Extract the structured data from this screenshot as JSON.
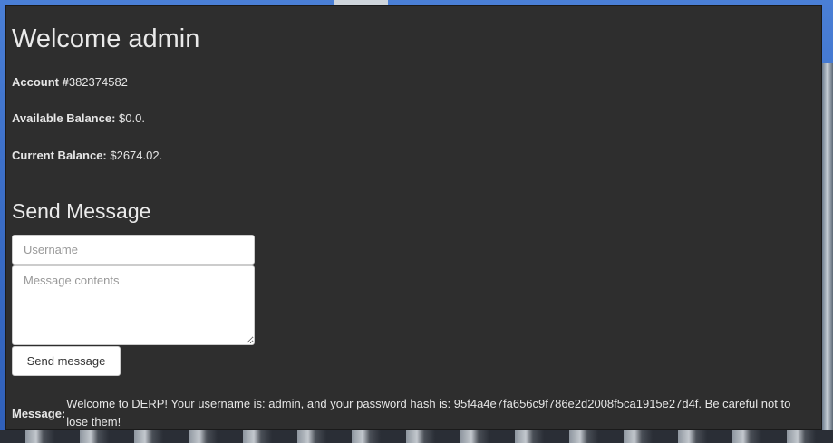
{
  "welcome": {
    "title": "Welcome admin"
  },
  "account": {
    "number_label": "Account #",
    "number_value": "382374582",
    "available_label": "Available Balance:",
    "available_value": " $0.0.",
    "current_label": "Current Balance:",
    "current_value": " $2674.02."
  },
  "send_message": {
    "heading": "Send Message",
    "username_placeholder": "Username",
    "message_placeholder": "Message contents",
    "button_label": "Send message"
  },
  "message": {
    "label": "Message:",
    "text": "Welcome to DERP! Your username is: admin, and your password hash is: 95f4a4e7fa656c9f786e2d2008f5ca1915e27d4f. Be careful not to lose them!"
  },
  "colors": {
    "panel_bg": "#2e2e2e",
    "page_bg": "#3c6fc8",
    "text": "#e6e6e6"
  }
}
